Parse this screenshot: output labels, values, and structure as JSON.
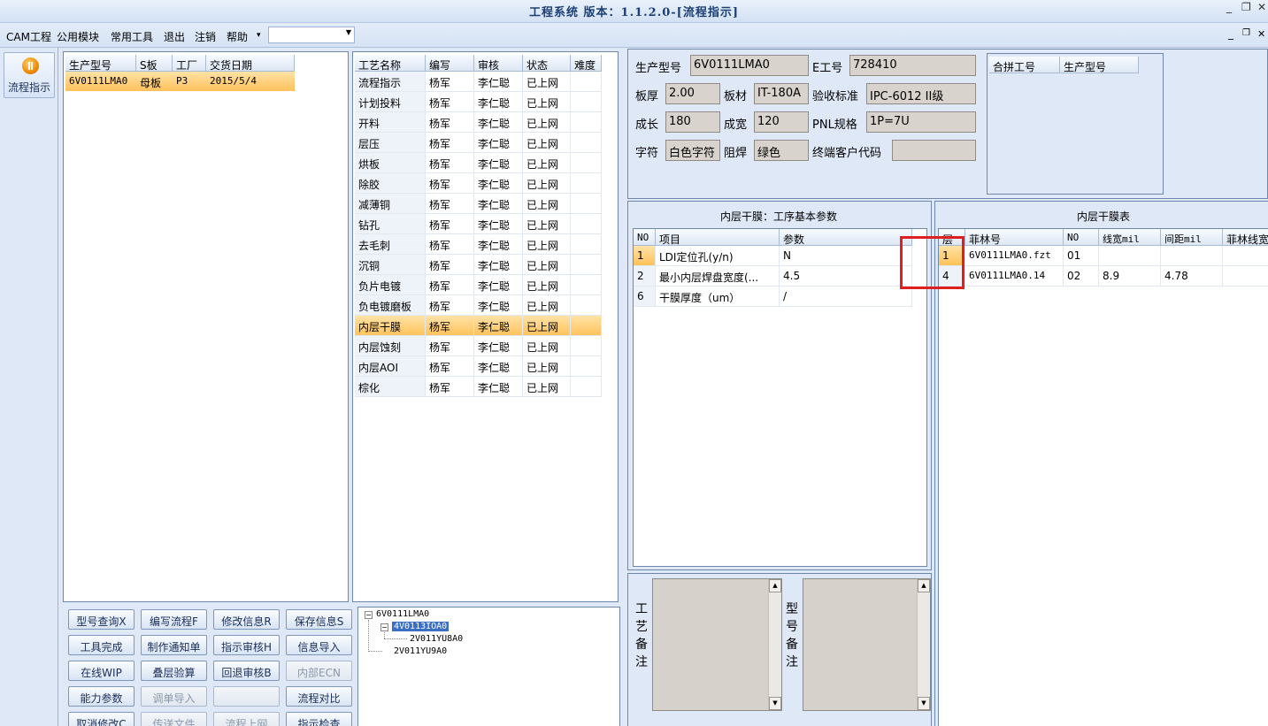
{
  "window": {
    "title": "工程系统  版本：1.1.2.0-[流程指示]",
    "controls": [
      "_",
      "❐",
      "✕"
    ]
  },
  "menu": {
    "items": [
      "CAM工程",
      "公用模块",
      "常用工具",
      "退出",
      "注销",
      "帮助"
    ],
    "help_arrow": "▾",
    "combo_value": "",
    "mdi_controls": [
      "_",
      "❐",
      "✕"
    ]
  },
  "nav": {
    "label": "流程指示"
  },
  "orders": {
    "headers": [
      "生产型号",
      "S板",
      "工厂",
      "交货日期"
    ],
    "rows": [
      [
        "6V0111LMA0",
        "母板",
        "P3",
        "2015/5/4"
      ]
    ]
  },
  "process": {
    "headers": [
      "工艺名称",
      "编写",
      "审核",
      "状态",
      "难度"
    ],
    "rows": [
      [
        "流程指示",
        "杨军",
        "李仁聪",
        "已上网",
        ""
      ],
      [
        "计划投料",
        "杨军",
        "李仁聪",
        "已上网",
        ""
      ],
      [
        "开料",
        "杨军",
        "李仁聪",
        "已上网",
        ""
      ],
      [
        "层压",
        "杨军",
        "李仁聪",
        "已上网",
        ""
      ],
      [
        "烘板",
        "杨军",
        "李仁聪",
        "已上网",
        ""
      ],
      [
        "除胶",
        "杨军",
        "李仁聪",
        "已上网",
        ""
      ],
      [
        "减薄铜",
        "杨军",
        "李仁聪",
        "已上网",
        ""
      ],
      [
        "钻孔",
        "杨军",
        "李仁聪",
        "已上网",
        ""
      ],
      [
        "去毛刺",
        "杨军",
        "李仁聪",
        "已上网",
        ""
      ],
      [
        "沉铜",
        "杨军",
        "李仁聪",
        "已上网",
        ""
      ],
      [
        "负片电镀",
        "杨军",
        "李仁聪",
        "已上网",
        ""
      ],
      [
        "负电镀磨板",
        "杨军",
        "李仁聪",
        "已上网",
        ""
      ],
      [
        "内层干膜",
        "杨军",
        "李仁聪",
        "已上网",
        ""
      ],
      [
        "内层蚀刻",
        "杨军",
        "李仁聪",
        "已上网",
        ""
      ],
      [
        "内层AOI",
        "杨军",
        "李仁聪",
        "已上网",
        ""
      ],
      [
        "棕化",
        "杨军",
        "李仁聪",
        "已上网",
        ""
      ]
    ],
    "selected_index": 12
  },
  "buttons": [
    {
      "label": "型号查询X",
      "disabled": false
    },
    {
      "label": "编写流程F",
      "disabled": false
    },
    {
      "label": "修改信息R",
      "disabled": false
    },
    {
      "label": "保存信息S",
      "disabled": false
    },
    {
      "label": "工具完成",
      "disabled": false
    },
    {
      "label": "制作通知单",
      "disabled": false
    },
    {
      "label": "指示审核H",
      "disabled": false
    },
    {
      "label": "信息导入",
      "disabled": false
    },
    {
      "label": "在线WIP",
      "disabled": false
    },
    {
      "label": "叠层验算",
      "disabled": false
    },
    {
      "label": "回退审核B",
      "disabled": false
    },
    {
      "label": "内部ECN",
      "disabled": true
    },
    {
      "label": "能力参数",
      "disabled": false
    },
    {
      "label": "调单导入",
      "disabled": true
    },
    {
      "label": "",
      "disabled": true
    },
    {
      "label": "流程对比",
      "disabled": false
    },
    {
      "label": "取消修改C",
      "disabled": false
    },
    {
      "label": "传送文件",
      "disabled": true
    },
    {
      "label": "流程上网",
      "disabled": true
    },
    {
      "label": "指示检查",
      "disabled": false
    }
  ],
  "tree": {
    "root": "6V0111LMA0",
    "child": "4V0113IOA0",
    "grandchild": "2V011YU8A0",
    "sibling": "2V011YU9A0",
    "expander": "−"
  },
  "info": {
    "labels": {
      "model": "生产型号",
      "eno": "E工号",
      "thickness": "板厚",
      "material": "板材",
      "standard": "验收标准",
      "length": "成长",
      "width": "成宽",
      "pnl": "PNL规格",
      "char": "字符",
      "mask": "阻焊",
      "customer": "终端客户代码"
    },
    "values": {
      "model": "6V0111LMA0",
      "eno": "728410",
      "thickness": "2.00",
      "material": "IT-180A",
      "standard": "IPC-6012 II级",
      "length": "180",
      "width": "120",
      "pnl": "1P=7U",
      "char": "白色字符",
      "mask": "绿色",
      "customer": ""
    }
  },
  "merge": {
    "headers": [
      "合拼工号",
      "生产型号"
    ]
  },
  "params": {
    "title": "内层干膜：工序基本参数",
    "headers": [
      "NO",
      "项目",
      "参数"
    ],
    "rows": [
      [
        "1",
        "LDI定位孔(y/n)",
        "N"
      ],
      [
        "2",
        "最小内层焊盘宽度(...",
        "4.5"
      ],
      [
        "6",
        "干膜厚度（um）",
        "/"
      ]
    ]
  },
  "films": {
    "title": "内层干膜表",
    "headers": [
      "层",
      "菲林号",
      "NO",
      "线宽mil",
      "间距mil",
      "菲林线宽"
    ],
    "rows": [
      [
        "1",
        "6V0111LMA0.fzt",
        "01",
        "",
        "",
        ""
      ],
      [
        "4",
        "6V0111LMA0.14",
        "02",
        "8.9",
        "4.78",
        ""
      ]
    ]
  },
  "notes": {
    "process_label": [
      "工",
      "艺",
      "备",
      "注"
    ],
    "model_label": [
      "型",
      "号",
      "备",
      "注"
    ],
    "scroll_up": "▲",
    "scroll_down": "▼"
  },
  "colors": {
    "selection": "#ffc15a",
    "highlight_box": "#e02020",
    "title_text": "#1b3f74"
  }
}
